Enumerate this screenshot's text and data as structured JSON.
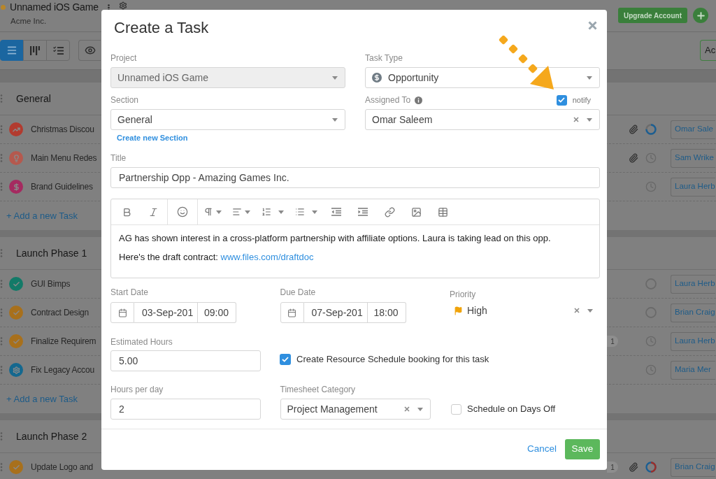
{
  "project": {
    "title": "Unnamed iOS Game",
    "subtitle": "Acme Inc."
  },
  "header": {
    "upgrade_button": "Upgrade Account"
  },
  "view_buttons": [
    {
      "kind": "list",
      "selected": true
    },
    {
      "kind": "board",
      "selected": false
    },
    {
      "kind": "tasks",
      "selected": false
    }
  ],
  "right_button": "Ac",
  "sections": [
    {
      "title": "General",
      "tasks": [
        {
          "name": "Christmas Discou",
          "kind": "chart",
          "color": "#b23b2f",
          "attachment": true,
          "status": {
            "kind": "ring"
          },
          "assignee": "Omar Sale"
        },
        {
          "name": "Main Menu Redes",
          "kind": "idea",
          "color": "#b5594e",
          "attachment": true,
          "status": {
            "kind": "clock"
          },
          "assignee": "Sam Wrike"
        },
        {
          "name": "Brand Guidelines",
          "kind": "money",
          "color": "#a52a60",
          "attachment": false,
          "status": {
            "kind": "clock"
          },
          "assignee": "Laura Herb"
        }
      ],
      "add_task": "+ Add a new Task"
    },
    {
      "title": "Launch Phase 1",
      "tasks": [
        {
          "name": "GUI Bimps",
          "kind": "done",
          "color": "#137a68",
          "attachment": false,
          "status": {
            "kind": "circle"
          },
          "assignee": "Laura Herb"
        },
        {
          "name": "Contract Design",
          "kind": "done",
          "color": "#a8701c",
          "attachment": false,
          "status": {
            "kind": "circle"
          },
          "assignee": "Brian Craig"
        },
        {
          "name": "Finalize Requirem",
          "kind": "done",
          "color": "#a8701c",
          "comments": "1",
          "attachment": false,
          "status": {
            "kind": "clock"
          },
          "assignee": "Laura Herb"
        },
        {
          "name": "Fix Legacy Accou",
          "kind": "gear",
          "color": "#14688f",
          "attachment": false,
          "status": {
            "kind": "clock"
          },
          "assignee": "Maria Mer"
        }
      ],
      "add_task": "+ Add a new Task"
    },
    {
      "title": "Launch Phase 2",
      "tasks": [
        {
          "name": "Update Logo and",
          "kind": "done",
          "color": "#a8701c",
          "comments": "1",
          "attachment": true,
          "status": {
            "kind": "ring_mixed"
          },
          "assignee": "Brian Craig"
        }
      ]
    }
  ],
  "dialog": {
    "title": "Create a Task",
    "project": {
      "label": "Project",
      "value": "Unnamed iOS Game",
      "disabled": true
    },
    "task_type": {
      "label": "Task Type",
      "value": "Opportunity"
    },
    "section": {
      "label": "Section",
      "value": "General",
      "link": "Create new Section"
    },
    "assigned_to": {
      "label": "Assigned To",
      "value": "Omar Saleem",
      "notify": {
        "label": "notify",
        "checked": true
      }
    },
    "title_field": {
      "label": "Title",
      "value": "Partnership Opp - Amazing Games Inc."
    },
    "editor_toolbar": [
      [
        {
          "kind": "bold",
          "dropdown": false
        },
        {
          "kind": "italic",
          "dropdown": false
        }
      ],
      [
        {
          "kind": "emoji",
          "dropdown": false
        }
      ],
      [
        {
          "kind": "paragraph",
          "dropdown": true
        },
        {
          "kind": "align",
          "dropdown": true
        },
        {
          "kind": "ordered_list",
          "dropdown": true
        },
        {
          "kind": "bullet_list",
          "dropdown": true
        },
        {
          "kind": "outdent",
          "dropdown": false
        },
        {
          "kind": "indent",
          "dropdown": false
        },
        {
          "kind": "link",
          "dropdown": false
        },
        {
          "kind": "image",
          "dropdown": false
        },
        {
          "kind": "table",
          "dropdown": false
        }
      ]
    ],
    "description": [
      {
        "text": "AG has shown interest in a cross-platform partnership with affiliate options. Laura is taking lead on this opp."
      },
      {
        "text": "Here's the draft contract: ",
        "link": "www.files.com/draftdoc"
      }
    ],
    "start_date": {
      "label": "Start Date",
      "date": "03-Sep-201",
      "time": "09:00"
    },
    "due_date": {
      "label": "Due Date",
      "date": "07-Sep-201",
      "time": "18:00"
    },
    "priority": {
      "label": "Priority",
      "value": "High"
    },
    "estimated_hours": {
      "label": "Estimated Hours",
      "value": "5.00"
    },
    "resource_booking": {
      "label": "Create Resource Schedule booking for this task",
      "checked": true
    },
    "hours_per_day": {
      "label": "Hours per day",
      "value": "2"
    },
    "timesheet_category": {
      "label": "Timesheet Category",
      "value": "Project Management"
    },
    "days_off": {
      "label": "Schedule on Days Off",
      "checked": false
    },
    "buttons": {
      "cancel": "Cancel",
      "save": "Save"
    }
  }
}
